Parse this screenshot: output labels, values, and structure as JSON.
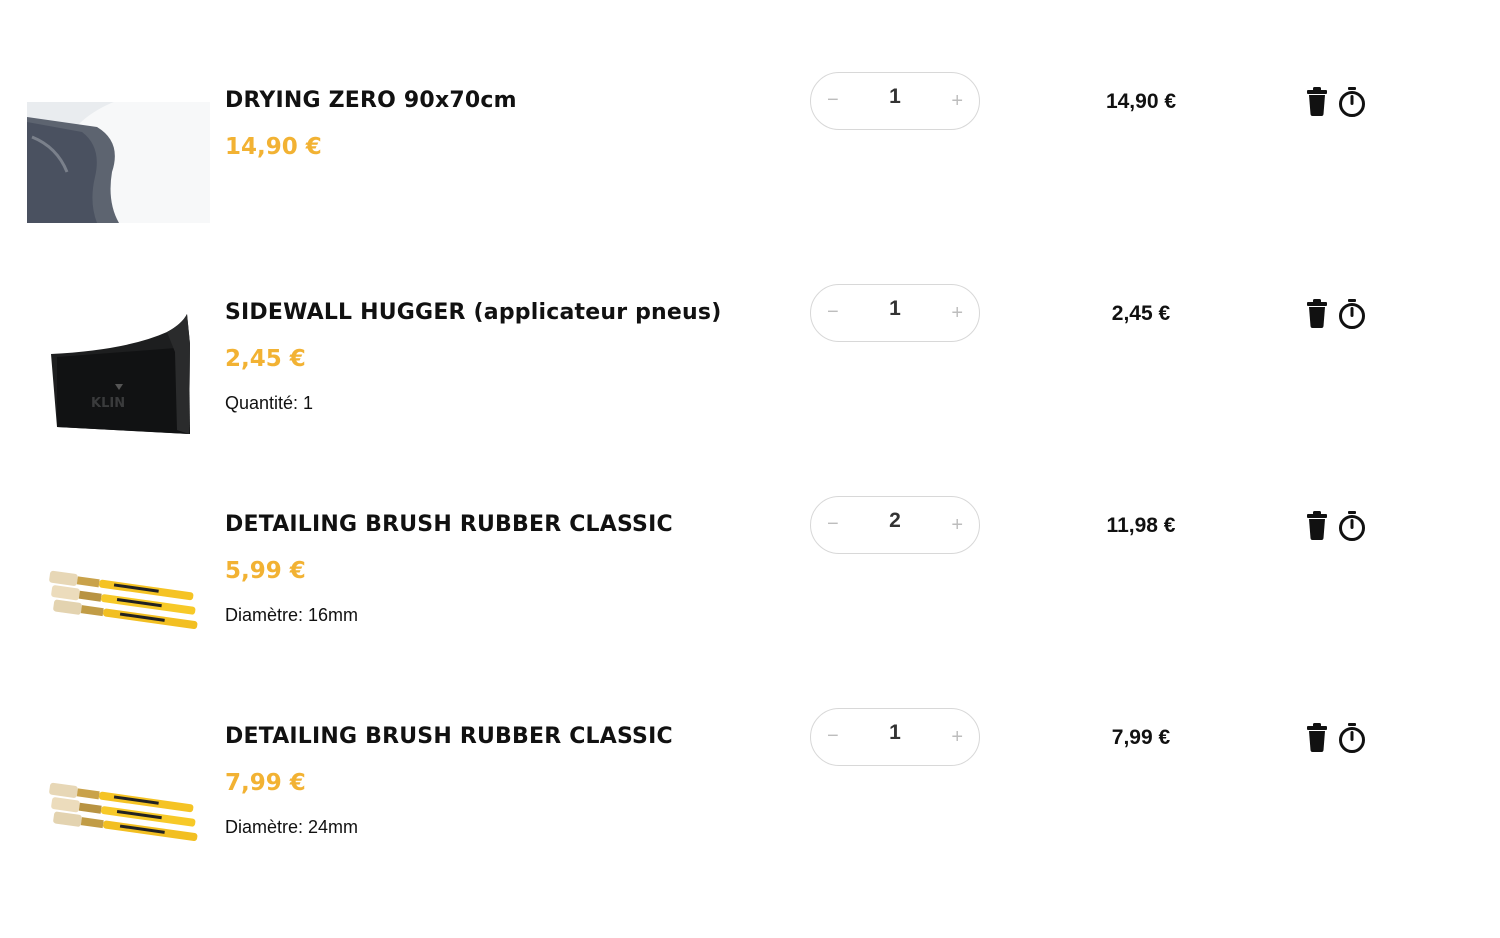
{
  "items": [
    {
      "image": "microfiber-towel-thumbnail",
      "title": "DRYING ZERO 90x70cm",
      "unit_price": "14,90 €",
      "variant": "",
      "quantity": "1",
      "line_total": "14,90 €"
    },
    {
      "image": "sidewall-applicator-thumbnail",
      "title": "SIDEWALL HUGGER (applicateur pneus)",
      "unit_price": "2,45 €",
      "variant": "Quantité: 1",
      "quantity": "1",
      "line_total": "2,45 €"
    },
    {
      "image": "detailing-brush-thumbnail",
      "title": "DETAILING BRUSH RUBBER CLASSIC",
      "unit_price": "5,99 €",
      "variant": "Diamètre: 16mm",
      "quantity": "2",
      "line_total": "11,98 €"
    },
    {
      "image": "detailing-brush-thumbnail",
      "title": "DETAILING BRUSH RUBBER CLASSIC",
      "unit_price": "7,99 €",
      "variant": "Diamètre: 24mm",
      "quantity": "1",
      "line_total": "7,99 €"
    }
  ],
  "controls": {
    "minus": "−",
    "plus": "+",
    "trash_icon": "trash-icon",
    "timer_icon": "stopwatch-icon"
  },
  "colors": {
    "price_accent": "#f2b233",
    "text": "#111111",
    "border": "#d8d8d8"
  }
}
